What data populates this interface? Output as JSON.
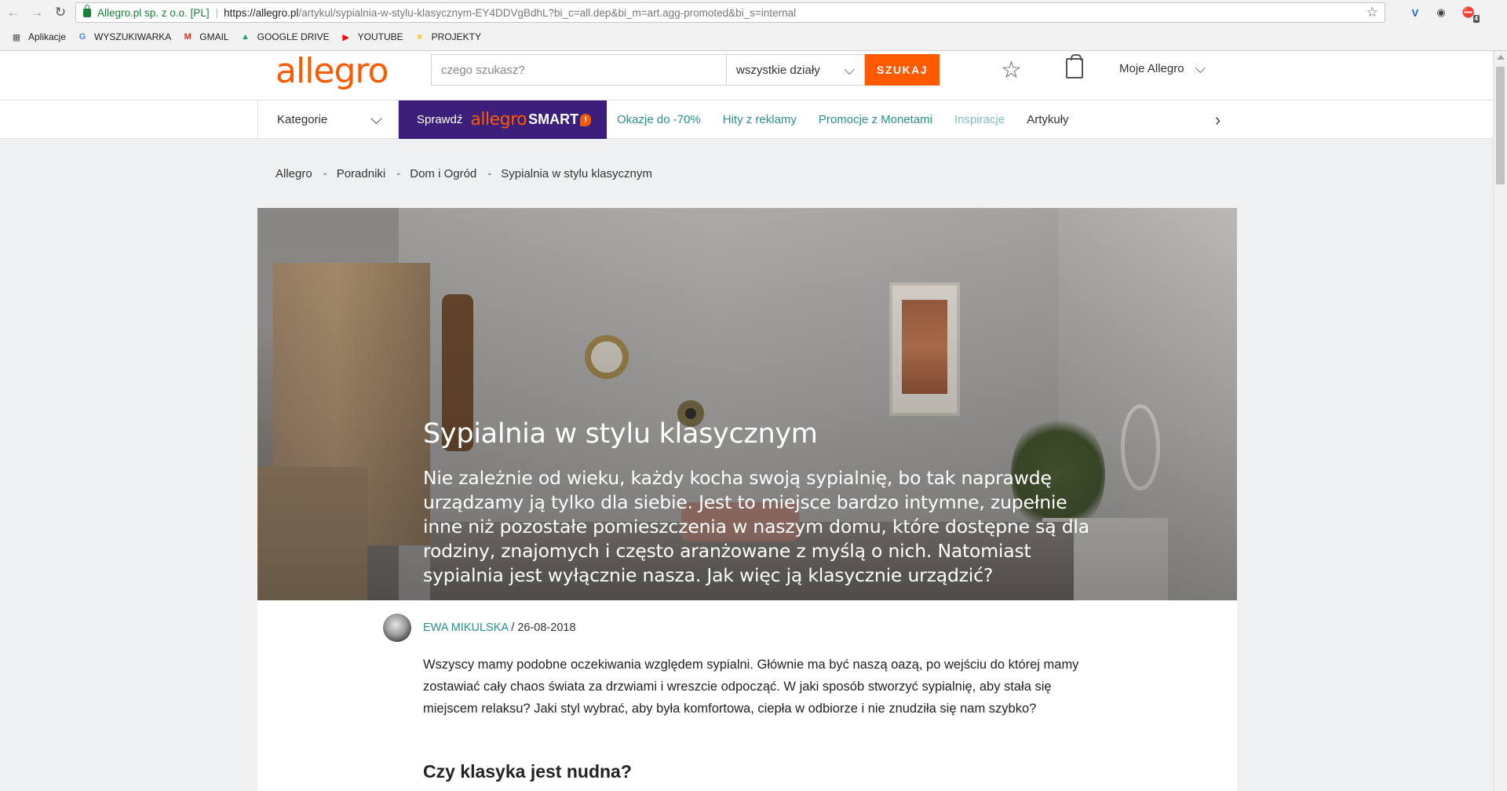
{
  "browser": {
    "site_identity": "Allegro.pl sp. z o.o. [PL]",
    "url_host": "https://allegro.pl",
    "url_path": "/artykul/sypialnia-w-stylu-klasycznym-EY4DDVgBdhL?bi_c=all.dep&bi_m=art.agg-promoted&bi_s=internal",
    "back_icon": "←",
    "forward_icon": "→",
    "reload_icon": "↻",
    "star_icon": "☆",
    "extensions": [
      {
        "name": "v-extension-icon",
        "glyph": "V",
        "color": "#1565c0"
      },
      {
        "name": "ghostery-icon",
        "glyph": "◉",
        "color": "#444444"
      },
      {
        "name": "adblock-icon",
        "glyph": "⛔",
        "color": "#d32f2f",
        "badge": "4"
      }
    ],
    "bookmarks": [
      {
        "label": "Aplikacje",
        "icon": "apps-grid-icon",
        "glyph": "▦",
        "color": "#555555"
      },
      {
        "label": "WYSZUKIWARKA",
        "icon": "google-icon",
        "glyph": "G",
        "color": "#4285f4"
      },
      {
        "label": "GMAIL",
        "icon": "gmail-icon",
        "glyph": "M",
        "color": "#d93025"
      },
      {
        "label": "GOOGLE DRIVE",
        "icon": "google-drive-icon",
        "glyph": "▲",
        "color": "#1fa463"
      },
      {
        "label": "YOUTUBE",
        "icon": "youtube-icon",
        "glyph": "▶",
        "color": "#ff0000"
      },
      {
        "label": "PROJEKTY",
        "icon": "folder-icon",
        "glyph": "■",
        "color": "#f5cd5b"
      }
    ]
  },
  "header": {
    "logo": "allegro",
    "search_placeholder": "czego szukasz?",
    "department": "wszystkie działy",
    "search_button": "SZUKAJ",
    "my_allegro": "Moje Allegro",
    "chevron": "⌵"
  },
  "catbar": {
    "categories": "Kategorie",
    "smart_prefix": "Sprawdź",
    "smart_brand": "allegro",
    "smart_word": "SMART",
    "smart_badge": "!",
    "links": [
      {
        "label": "Okazje do -70%",
        "style": ""
      },
      {
        "label": "Hity z reklamy",
        "style": ""
      },
      {
        "label": "Promocje z Monetami",
        "style": ""
      },
      {
        "label": "Inspiracje",
        "style": "muted"
      },
      {
        "label": "Artykuły",
        "style": "dark"
      }
    ],
    "next_icon": "›"
  },
  "breadcrumb": [
    "Allegro",
    "Poradniki",
    "Dom i Ogród",
    "Sypialnia w stylu klasycznym"
  ],
  "breadcrumb_sep": "-",
  "hero": {
    "title": "Sypialnia w stylu klasycznym",
    "lead": "Nie zależnie od wieku, każdy kocha swoją sypialnię, bo tak naprawdę urządzamy ją tylko dla siebie. Jest to miejsce bardzo intymne, zupełnie inne niż pozostałe pomieszczenia w naszym domu, które dostępne są dla rodziny, znajomych i często aranżowane z myślą o nich. Natomiast sypialnia jest wyłącznie nasza. Jak więc ją klasycznie urządzić?"
  },
  "article": {
    "author": "EWA MIKULSKA",
    "date_prefix": " / ",
    "date": "26-08-2018",
    "body": "Wszyscy mamy podobne oczekiwania względem sypialni. Głównie ma być naszą oazą, po wejściu do której mamy zostawiać cały chaos świata za drzwiami i wreszcie odpocząć. W jaki sposób stworzyć sypialnię, aby stała się miejscem relaksu? Jaki styl wybrać, aby była komfortowa, ciepła w odbiorze i nie znudziła się nam szybko?",
    "subheading": "Czy klasyka jest nudna?"
  }
}
